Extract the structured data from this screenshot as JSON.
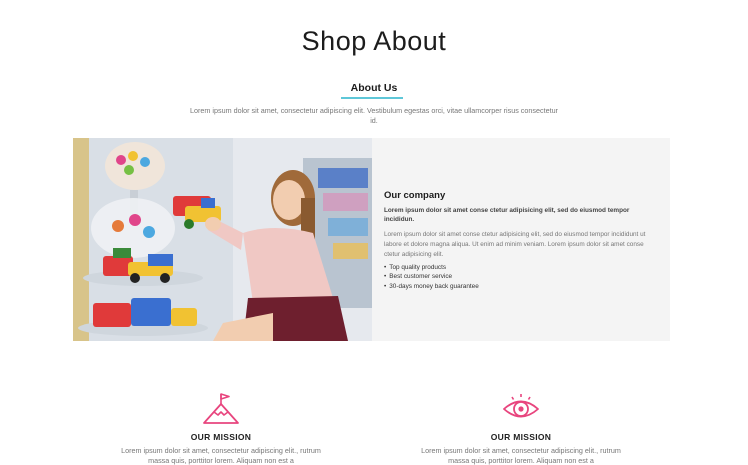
{
  "header": {
    "title": "Shop About"
  },
  "about": {
    "heading": "About Us",
    "description": "Lorem ipsum dolor sit amet, consectetur adipiscing elit. Vestibulum egestas orci, vitae ullamcorper risus consectetur id."
  },
  "company": {
    "title": "Our company",
    "lead": "Lorem ipsum dolor sit amet conse ctetur adipisicing elit, sed do eiusmod tempor incididun.",
    "text": "Lorem ipsum dolor sit amet conse ctetur adipisicing elit, sed do eiusmod tempor incididunt ut labore et dolore magna aliqua. Ut enim ad minim veniam. Lorem ipsum dolor sit amet conse ctetur adipisicing elit.",
    "bullets": [
      "Top quality products",
      "Best customer service",
      "30-days money back guarantee"
    ]
  },
  "missions": [
    {
      "icon": "flag-mountain-icon",
      "title": "OUR MISSION",
      "text": "Lorem ipsum dolor sit amet, consectetur adipiscing elit., rutrum massa quis, porttitor lorem. Aliquam non est a"
    },
    {
      "icon": "eye-icon",
      "title": "OUR MISSION",
      "text": "Lorem ipsum dolor sit amet, consectetur adipiscing elit., rutrum massa quis, porttitor lorem. Aliquam non est a"
    }
  ],
  "colors": {
    "accent_line": "#5ec7d8",
    "icon_pink": "#e8457e",
    "panel_bg": "#f4f4f4"
  }
}
